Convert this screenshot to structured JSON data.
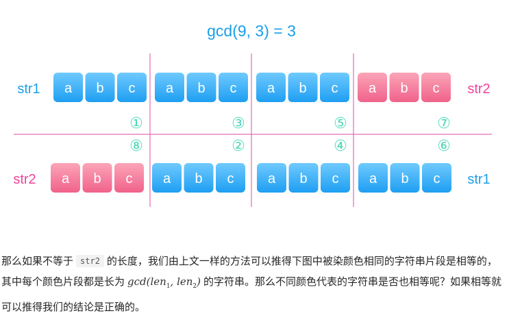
{
  "title": "gcd(9, 3) = 3",
  "rows": [
    {
      "id": "top",
      "left_label": "str1",
      "right_label": "str2",
      "groups": [
        {
          "letters": [
            "a",
            "b",
            "c"
          ],
          "color": "blue"
        },
        {
          "letters": [
            "a",
            "b",
            "c"
          ],
          "color": "blue"
        },
        {
          "letters": [
            "a",
            "b",
            "c"
          ],
          "color": "blue"
        },
        {
          "letters": [
            "a",
            "b",
            "c"
          ],
          "color": "pink"
        }
      ]
    },
    {
      "id": "bottom",
      "left_label": "str2",
      "right_label": "str1",
      "groups": [
        {
          "letters": [
            "a",
            "b",
            "c"
          ],
          "color": "pink"
        },
        {
          "letters": [
            "a",
            "b",
            "c"
          ],
          "color": "blue"
        },
        {
          "letters": [
            "a",
            "b",
            "c"
          ],
          "color": "blue"
        },
        {
          "letters": [
            "a",
            "b",
            "c"
          ],
          "color": "blue"
        }
      ]
    }
  ],
  "markers_upper": [
    "①",
    "③",
    "⑤",
    "⑦"
  ],
  "markers_lower": [
    "⑧",
    "②",
    "④",
    "⑥"
  ],
  "colors": {
    "blue": "#1e9ff2",
    "blue_light": "#6fcafe",
    "pink": "#f0628a",
    "pink_light": "#fba5b8",
    "label_blue": "#1a9ee8",
    "label_pink": "#f0439a",
    "title": "#1a9ee8",
    "divider": "#e46ab8",
    "marker": "#4fd8b8"
  },
  "paragraph": {
    "t1": "那么如果不等于",
    "code": "str2",
    "t2": "的长度，我们由上文一样的方法可以推得下图中被染颜色相同的字符串片段是相等的，其中每个颜色片段都是长为",
    "math_prefix": "gcd(len",
    "math_sub1": "1",
    "math_mid": ", len",
    "math_sub2": "2",
    "math_suffix": ")",
    "t3": "的字符串。那么不同颜色代表的字符串是否也相等呢？如果相等就可以推得我们的结论是正确的。"
  }
}
